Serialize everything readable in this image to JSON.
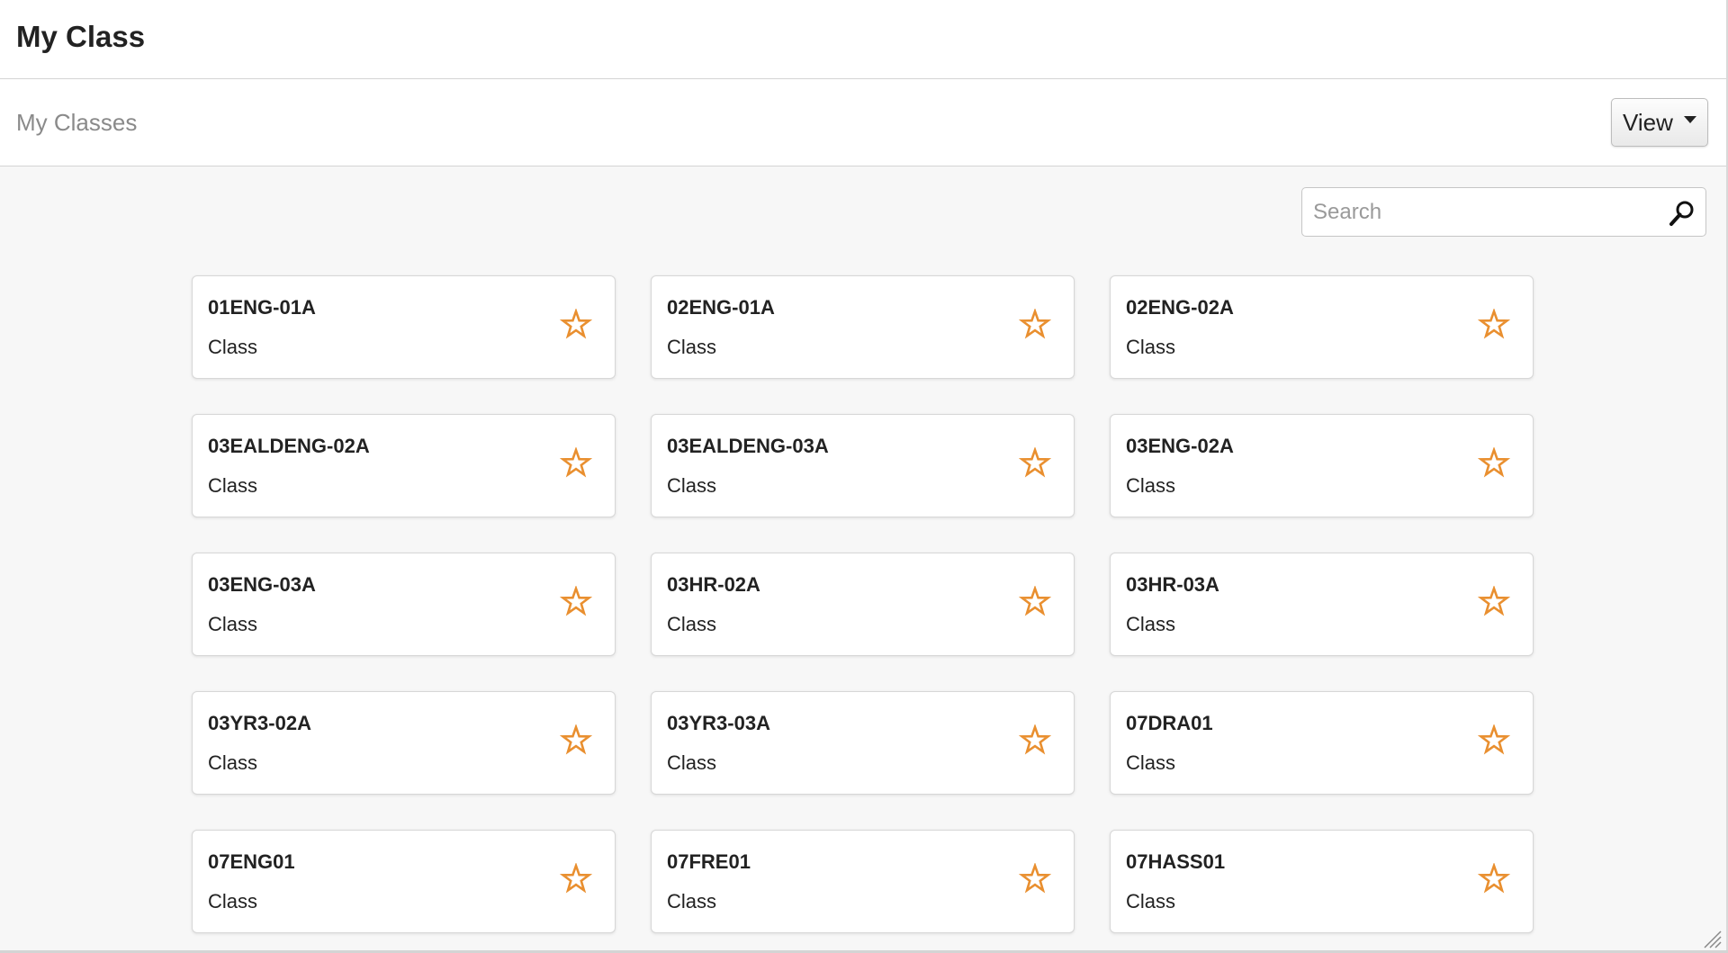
{
  "header": {
    "title": "My Class"
  },
  "subheader": {
    "title": "My Classes",
    "view_label": "View"
  },
  "search": {
    "placeholder": "Search",
    "value": ""
  },
  "colors": {
    "star": "#e98f2f",
    "accent_border": "#d7d7d7"
  },
  "icons": {
    "favorite": "star-outline-icon",
    "search": "magnifier-icon",
    "dropdown": "caret-down-icon"
  },
  "classes": [
    {
      "name": "01ENG-01A",
      "type": "Class"
    },
    {
      "name": "02ENG-01A",
      "type": "Class"
    },
    {
      "name": "02ENG-02A",
      "type": "Class"
    },
    {
      "name": "03EALDENG-02A",
      "type": "Class"
    },
    {
      "name": "03EALDENG-03A",
      "type": "Class"
    },
    {
      "name": "03ENG-02A",
      "type": "Class"
    },
    {
      "name": "03ENG-03A",
      "type": "Class"
    },
    {
      "name": "03HR-02A",
      "type": "Class"
    },
    {
      "name": "03HR-03A",
      "type": "Class"
    },
    {
      "name": "03YR3-02A",
      "type": "Class"
    },
    {
      "name": "03YR3-03A",
      "type": "Class"
    },
    {
      "name": "07DRA01",
      "type": "Class"
    },
    {
      "name": "07ENG01",
      "type": "Class"
    },
    {
      "name": "07FRE01",
      "type": "Class"
    },
    {
      "name": "07HASS01",
      "type": "Class"
    }
  ]
}
